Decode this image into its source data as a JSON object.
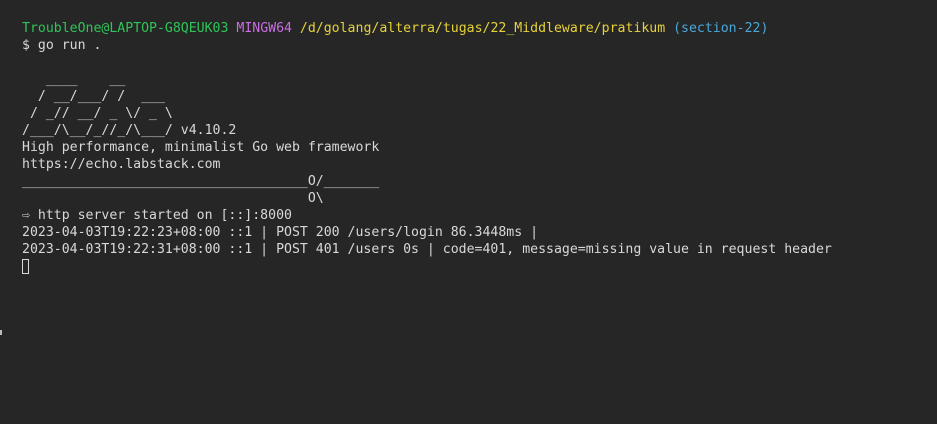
{
  "prompt": {
    "user_host": "TroubleOne@LAPTOP-G8QEUK03",
    "shell": "MINGW64",
    "path": "/d/golang/alterra/tugas/22_Middleware/pratikum",
    "branch": "(section-22)",
    "command": "$ go run ."
  },
  "banner": [
    "   ____    __",
    "  / __/___/ /  ___",
    " / _// __/ _ \\/ _ \\",
    "/___/\\__/_//_/\\___/ v4.10.2",
    "High performance, minimalist Go web framework",
    "https://echo.labstack.com",
    "____________________________________O/_______",
    "                                    O\\"
  ],
  "output": [
    "⇨ http server started on [::]:8000",
    "2023-04-03T19:22:23+08:00 ::1 | POST 200 /users/login 86.3448ms |",
    "2023-04-03T19:22:31+08:00 ::1 | POST 401 /users 0s | code=401, message=missing value in request header"
  ],
  "colors": {
    "background": "#262626",
    "text": "#d8d8d8",
    "user_host": "#2fc45a",
    "shell": "#c86ee0",
    "path": "#e6d23a",
    "branch": "#4aa8d8"
  }
}
